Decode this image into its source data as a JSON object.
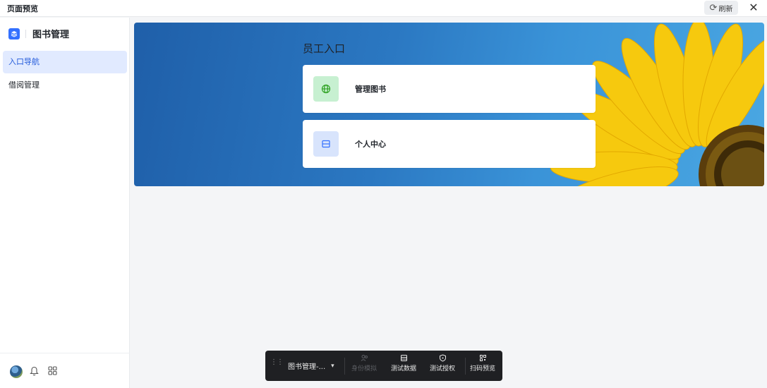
{
  "window": {
    "title": "页面预览",
    "refresh_label": "刷新",
    "close_glyph": "✕"
  },
  "sidebar": {
    "app_name": "图书管理",
    "items": [
      {
        "label": "入口导航",
        "active": true
      },
      {
        "label": "借阅管理",
        "active": false
      }
    ],
    "footer_icons": [
      "avatar",
      "bell-icon",
      "apps-grid-icon"
    ]
  },
  "main": {
    "entry_title": "员工入口",
    "cards": [
      {
        "label": "管理图书",
        "icon": "globe-icon",
        "icon_bg": "#c7f0d1",
        "icon_color": "#2ea121"
      },
      {
        "label": "个人中心",
        "icon": "panel-icon",
        "icon_bg": "#d8e4fc",
        "icon_color": "#3370ff"
      }
    ]
  },
  "toolbar": {
    "app_select": "图书管理-...",
    "buttons": [
      {
        "label": "身份模拟",
        "icon": "users-icon",
        "disabled": true
      },
      {
        "label": "测试数据",
        "icon": "table-icon",
        "disabled": false
      },
      {
        "label": "测试授权",
        "icon": "shield-icon",
        "disabled": false
      },
      {
        "label": "扫码预览",
        "icon": "qrcode-icon",
        "disabled": false
      }
    ]
  },
  "colors": {
    "accent": "#3370ff",
    "active_nav_bg": "#e1eaff",
    "banner_blue": "#2b78c2",
    "toolbar_bg": "#1f2023"
  }
}
